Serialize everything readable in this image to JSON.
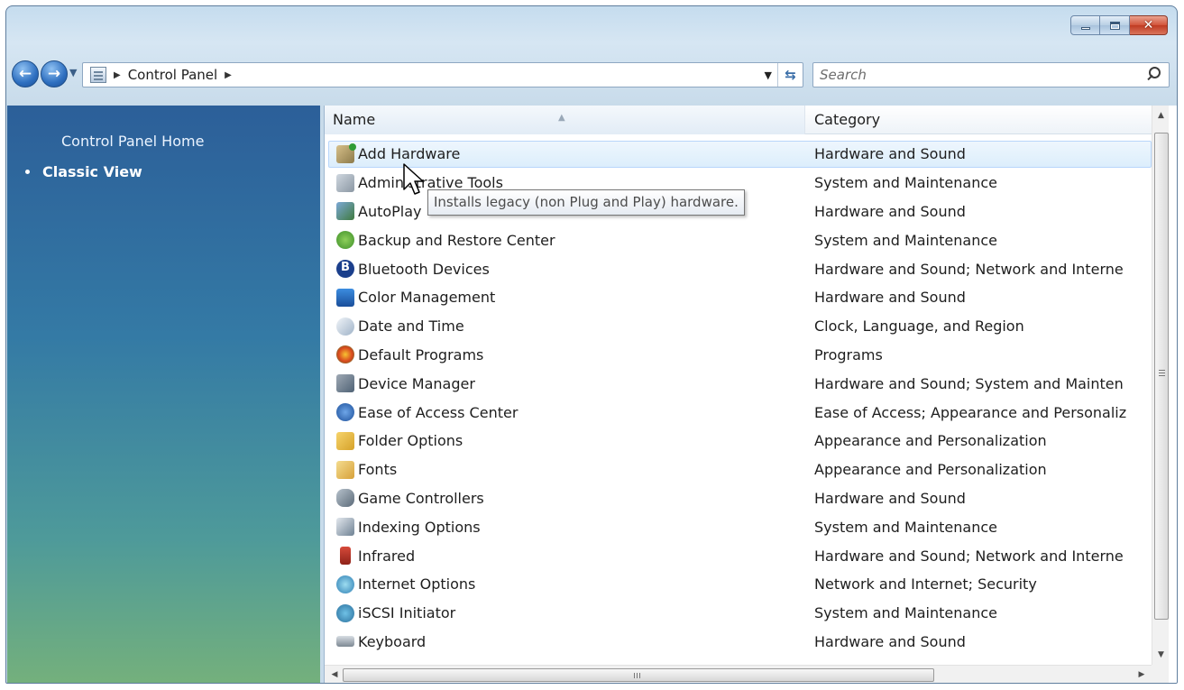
{
  "window": {
    "caption": {
      "minimize": "",
      "maximize": "",
      "close": "✕"
    }
  },
  "address_bar": {
    "breadcrumbs": [
      "Control Panel"
    ],
    "search_placeholder": "Search"
  },
  "sidebar": {
    "home_link": "Control Panel Home",
    "current_view": "Classic View"
  },
  "list": {
    "columns": {
      "name": "Name",
      "category": "Category"
    },
    "selected_index": 0,
    "items": [
      {
        "name": "Add Hardware",
        "category": "Hardware and Sound",
        "icon": "add-hardware-icon"
      },
      {
        "name": "Administrative Tools",
        "category": "System and Maintenance",
        "icon": "administrative-tools-icon"
      },
      {
        "name": "AutoPlay",
        "category": "Hardware and Sound",
        "icon": "autoplay-icon"
      },
      {
        "name": "Backup and Restore Center",
        "category": "System and Maintenance",
        "icon": "backup-icon"
      },
      {
        "name": "Bluetooth Devices",
        "category": "Hardware and Sound; Network and Interne",
        "icon": "bluetooth-icon"
      },
      {
        "name": "Color Management",
        "category": "Hardware and Sound",
        "icon": "color-management-icon"
      },
      {
        "name": "Date and Time",
        "category": "Clock, Language, and Region",
        "icon": "date-time-icon"
      },
      {
        "name": "Default Programs",
        "category": "Programs",
        "icon": "default-programs-icon"
      },
      {
        "name": "Device Manager",
        "category": "Hardware and Sound; System and Mainten",
        "icon": "device-manager-icon"
      },
      {
        "name": "Ease of Access Center",
        "category": "Ease of Access; Appearance and Personaliz",
        "icon": "ease-of-access-icon"
      },
      {
        "name": "Folder Options",
        "category": "Appearance and Personalization",
        "icon": "folder-options-icon"
      },
      {
        "name": "Fonts",
        "category": "Appearance and Personalization",
        "icon": "fonts-icon"
      },
      {
        "name": "Game Controllers",
        "category": "Hardware and Sound",
        "icon": "game-controllers-icon"
      },
      {
        "name": "Indexing Options",
        "category": "System and Maintenance",
        "icon": "indexing-options-icon"
      },
      {
        "name": "Infrared",
        "category": "Hardware and Sound; Network and Interne",
        "icon": "infrared-icon"
      },
      {
        "name": "Internet Options",
        "category": "Network and Internet; Security",
        "icon": "internet-options-icon"
      },
      {
        "name": "iSCSI Initiator",
        "category": "System and Maintenance",
        "icon": "iscsi-icon"
      },
      {
        "name": "Keyboard",
        "category": "Hardware and Sound",
        "icon": "keyboard-icon"
      }
    ]
  },
  "tooltip": {
    "text": "Installs legacy (non Plug and Play) hardware."
  }
}
